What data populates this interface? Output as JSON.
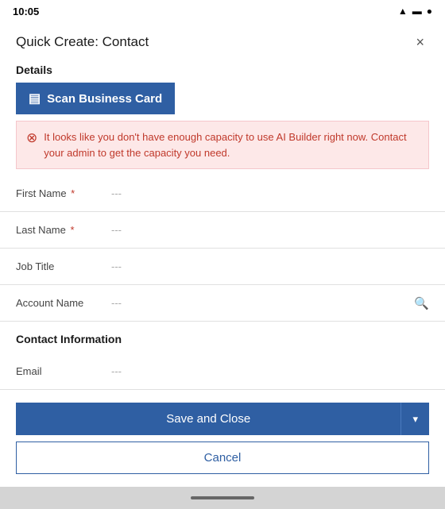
{
  "statusBar": {
    "time": "10:05",
    "icons": "▲ ●"
  },
  "header": {
    "title": "Quick Create: Contact",
    "closeLabel": "×"
  },
  "details": {
    "sectionLabel": "Details",
    "scanButton": {
      "label": "Scan Business Card",
      "icon": "▤"
    },
    "errorBox": {
      "iconSymbol": "⊗",
      "message": "It looks like you don't have enough capacity to use AI Builder right now. Contact your admin to get the capacity you need."
    },
    "fields": [
      {
        "label": "First Name",
        "required": true,
        "placeholder": "---",
        "hasSearch": false
      },
      {
        "label": "Last Name",
        "required": true,
        "placeholder": "---",
        "hasSearch": false
      },
      {
        "label": "Job Title",
        "required": false,
        "placeholder": "---",
        "hasSearch": false
      },
      {
        "label": "Account Name",
        "required": false,
        "placeholder": "---",
        "hasSearch": true
      }
    ]
  },
  "contactInfo": {
    "sectionLabel": "Contact Information",
    "fields": [
      {
        "label": "Email",
        "required": false,
        "placeholder": "---",
        "hasSearch": false
      }
    ]
  },
  "actions": {
    "saveCloseLabel": "Save and Close",
    "chevronLabel": "▾",
    "cancelLabel": "Cancel"
  },
  "colors": {
    "primary": "#2f5fa3",
    "error": "#c0392b",
    "errorBg": "#fde8e8"
  }
}
